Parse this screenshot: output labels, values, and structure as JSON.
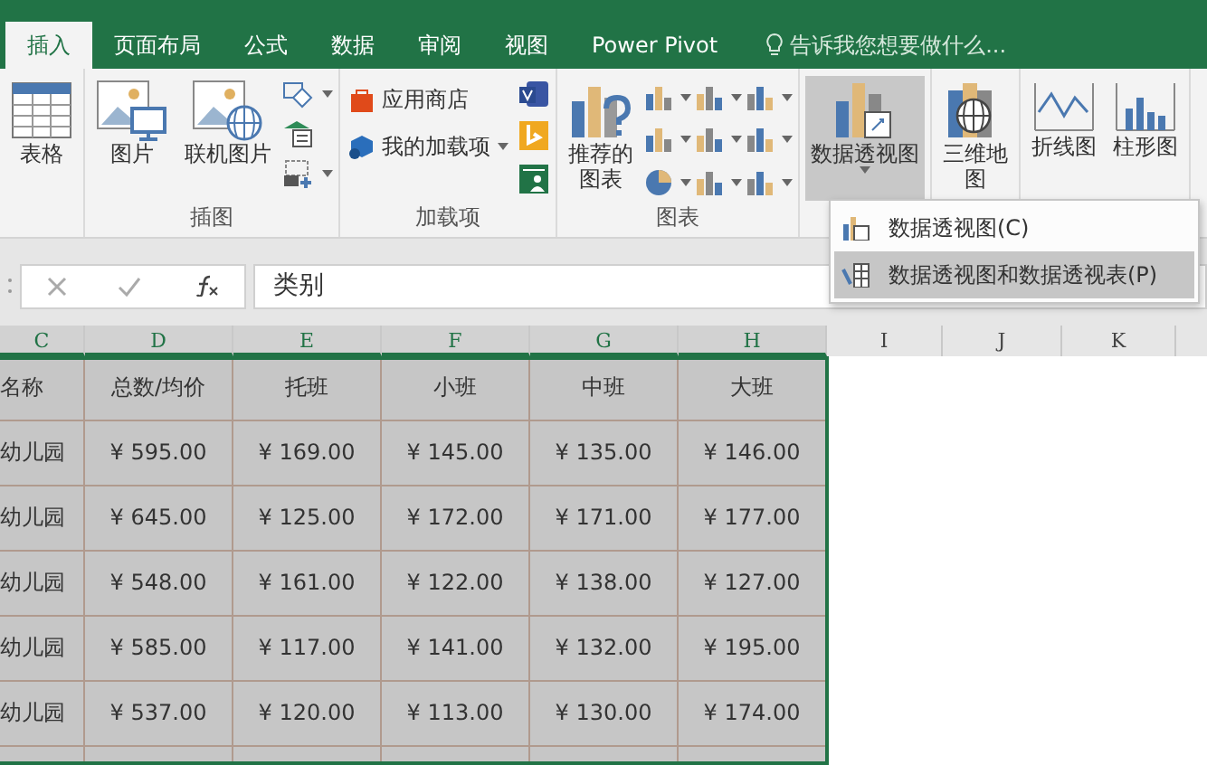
{
  "tabs": [
    {
      "label": "插入",
      "selected": true
    },
    {
      "label": "页面布局",
      "selected": false
    },
    {
      "label": "公式",
      "selected": false
    },
    {
      "label": "数据",
      "selected": false
    },
    {
      "label": "审阅",
      "selected": false
    },
    {
      "label": "视图",
      "selected": false
    },
    {
      "label": "Power Pivot",
      "selected": false
    }
  ],
  "tell_me": {
    "placeholder": "告诉我您想要做什么..."
  },
  "ribbon": [
    {
      "buttons": [
        {
          "kind": "table",
          "label": "表格"
        }
      ]
    },
    {
      "label": "插图",
      "buttons": [
        {
          "kind": "picture",
          "label": "图片"
        },
        {
          "kind": "online",
          "label": "联机图片"
        },
        {
          "kind": "smalls",
          "icons": [
            {
              "kind": "shapes",
              "dropdown": true
            },
            {
              "kind": "smartart",
              "dropdown": false
            },
            {
              "kind": "screenshot",
              "dropdown": true
            }
          ]
        }
      ]
    },
    {
      "label": "加载项",
      "buttons": [
        {
          "kind": "addins",
          "items": [
            {
              "kind": "store",
              "label": "应用商店"
            },
            {
              "kind": "myaddins",
              "label": "我的加载项"
            }
          ]
        },
        {
          "kind": "smalls",
          "icons": [
            {
              "kind": "visio",
              "dropdown": false
            },
            {
              "kind": "bing",
              "dropdown": false
            },
            {
              "kind": "people",
              "dropdown": false
            }
          ]
        }
      ]
    },
    {
      "label": "图表",
      "buttons": [
        {
          "kind": "recommend",
          "label": "推荐的图表"
        },
        {
          "kind": "chartgrid"
        }
      ]
    },
    {
      "buttons": [
        {
          "kind": "pivot",
          "label": "数据透视图",
          "expanded": true
        }
      ]
    },
    {
      "buttons": [
        {
          "kind": "map",
          "label": "三维地图"
        }
      ]
    },
    {
      "buttons": [
        {
          "kind": "line",
          "label": "折线图"
        },
        {
          "kind": "column",
          "label": "柱形图"
        }
      ]
    }
  ],
  "menu": [
    {
      "label": "数据透视图(C)",
      "selected": false
    },
    {
      "label": "数据透视图和数据透视表(P)",
      "selected": true
    }
  ],
  "formula_bar": {
    "value": "类别"
  },
  "sheet": {
    "columns": [
      {
        "label": "C",
        "selected": true
      },
      {
        "label": "D",
        "selected": true
      },
      {
        "label": "E",
        "selected": true
      },
      {
        "label": "F",
        "selected": true
      },
      {
        "label": "G",
        "selected": true
      },
      {
        "label": "H",
        "selected": true
      },
      {
        "label": "I",
        "selected": false
      },
      {
        "label": "J",
        "selected": false
      },
      {
        "label": "K",
        "selected": false
      }
    ],
    "rows": [
      [
        "名称",
        "总数/均价",
        "托班",
        "小班",
        "中班",
        "大班"
      ],
      [
        "幼儿园",
        "¥ 595.00",
        "¥ 169.00",
        "¥ 145.00",
        "¥ 135.00",
        "¥ 146.00"
      ],
      [
        "幼儿园",
        "¥ 645.00",
        "¥ 125.00",
        "¥ 172.00",
        "¥ 171.00",
        "¥ 177.00"
      ],
      [
        "幼儿园",
        "¥ 548.00",
        "¥ 161.00",
        "¥ 122.00",
        "¥ 138.00",
        "¥ 127.00"
      ],
      [
        "幼儿园",
        "¥ 585.00",
        "¥ 117.00",
        "¥ 141.00",
        "¥ 132.00",
        "¥ 195.00"
      ],
      [
        "幼儿园",
        "¥ 537.00",
        "¥ 120.00",
        "¥ 113.00",
        "¥ 130.00",
        "¥ 174.00"
      ],
      [
        "",
        "",
        "",
        "",
        "",
        ""
      ]
    ]
  }
}
